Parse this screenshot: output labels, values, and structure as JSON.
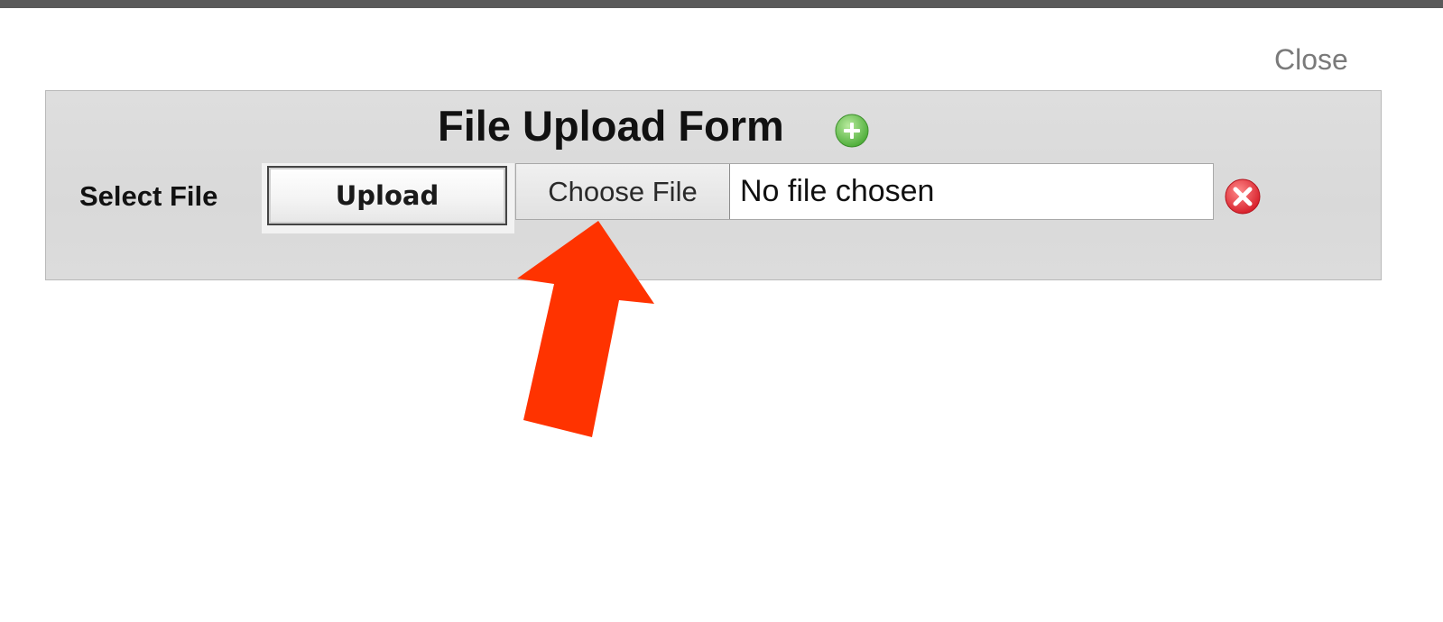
{
  "dialog": {
    "close_label": "Close"
  },
  "form": {
    "title": "File Upload Form",
    "select_label": "Select File",
    "upload_label": "Upload",
    "choose_file_label": "Choose File",
    "file_status": "No file chosen"
  },
  "icons": {
    "add": "add-circle-icon",
    "remove": "remove-circle-icon",
    "annotation": "red-arrow-annotation"
  },
  "colors": {
    "panel_bg": "#dcdcdc",
    "add_icon": "#6dc45a",
    "remove_icon": "#e8424a",
    "arrow": "#ff3300",
    "close_text": "#7a7a7a"
  }
}
